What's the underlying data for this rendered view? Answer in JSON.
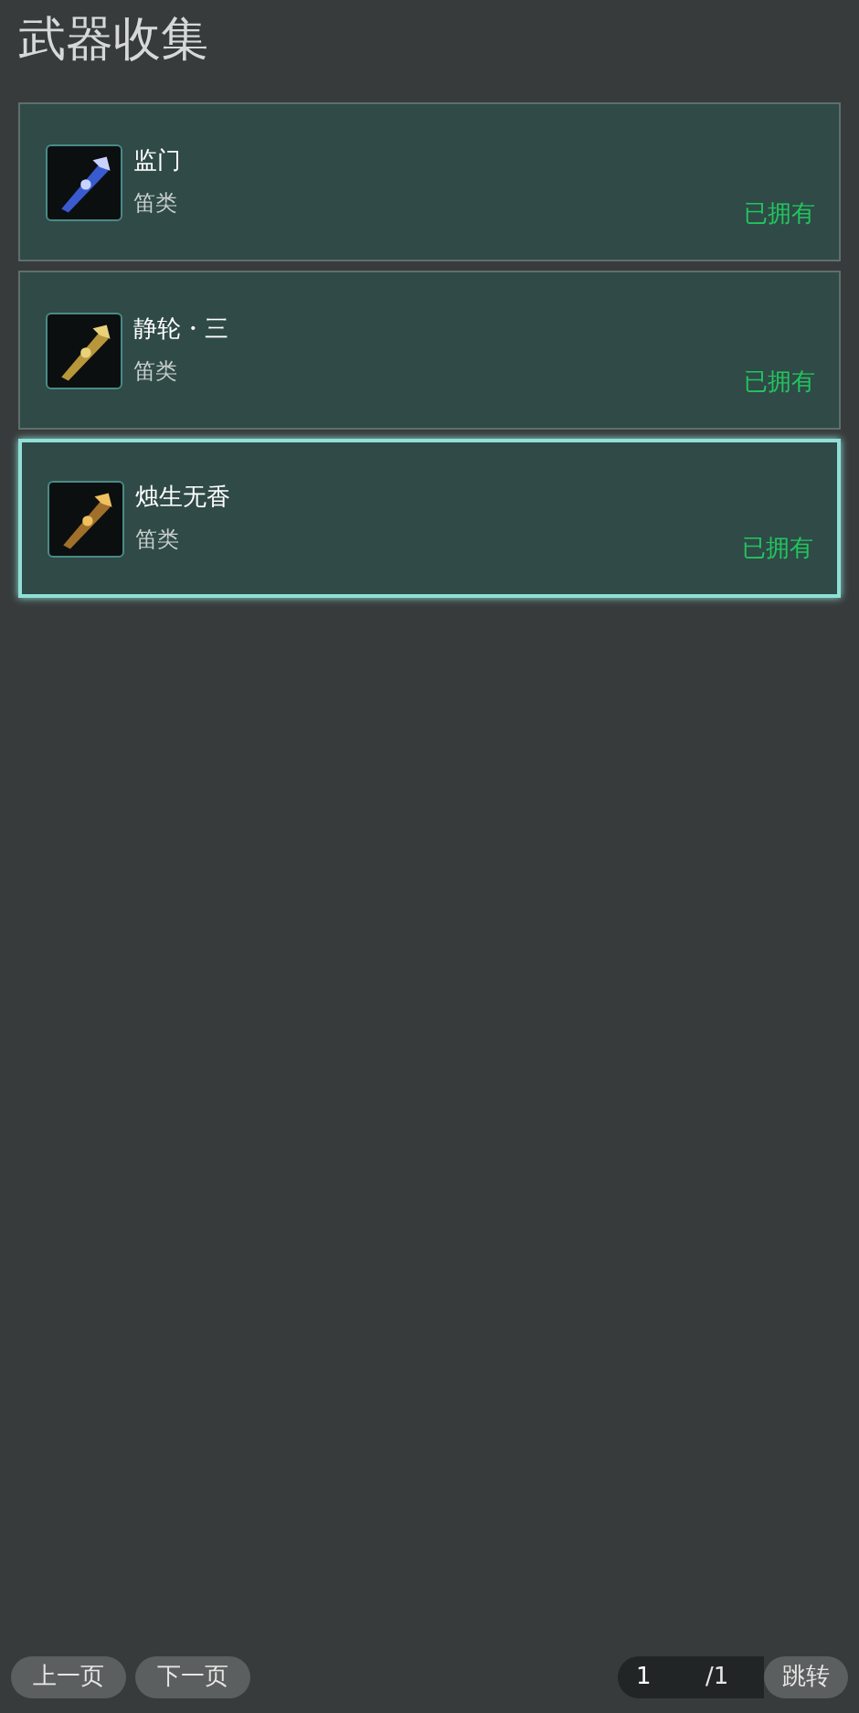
{
  "title": "武器收集",
  "items": [
    {
      "name": "监门",
      "category": "笛类",
      "status": "已拥有",
      "selected": false
    },
    {
      "name": "静轮・三",
      "category": "笛类",
      "status": "已拥有",
      "selected": false
    },
    {
      "name": "烛生无香",
      "category": "笛类",
      "status": "已拥有",
      "selected": true
    }
  ],
  "pagination": {
    "prev": "上一页",
    "next": "下一页",
    "page_value": "1",
    "page_total": "/1",
    "jump": "跳转"
  }
}
